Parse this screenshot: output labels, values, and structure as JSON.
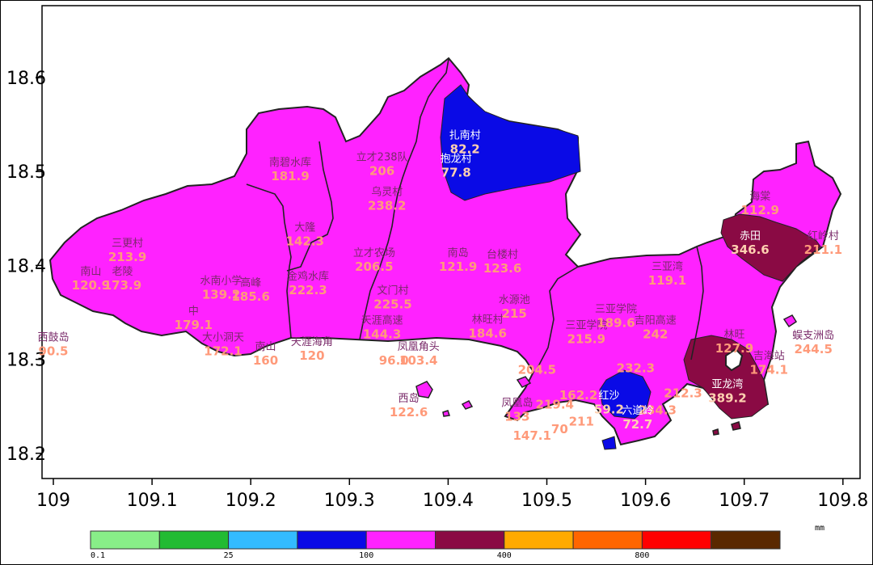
{
  "axes": {
    "x_ticks": [
      "109",
      "109.1",
      "109.2",
      "109.3",
      "109.4",
      "109.5",
      "109.6",
      "109.7",
      "109.8"
    ],
    "y_ticks": [
      "18.6",
      "18.5",
      "18.4",
      "18.3",
      "18.2"
    ]
  },
  "stations": [
    {
      "name": "扎南村",
      "value": "82.2",
      "lon": 109.417,
      "lat": 18.535,
      "zone": "blue"
    },
    {
      "name": "抱龙村",
      "value": "77.8",
      "lon": 109.408,
      "lat": 18.51,
      "zone": "blue"
    },
    {
      "name": "南碧水库",
      "value": "181.9",
      "lon": 109.24,
      "lat": 18.506,
      "zone": "magenta"
    },
    {
      "name": "立才238队",
      "value": "206",
      "lon": 109.333,
      "lat": 18.512,
      "zone": "magenta"
    },
    {
      "name": "乌灵村",
      "value": "238.2",
      "lon": 109.338,
      "lat": 18.475,
      "zone": "magenta"
    },
    {
      "name": "三更村",
      "value": "213.9",
      "lon": 109.075,
      "lat": 18.42,
      "zone": "magenta"
    },
    {
      "name": "南山",
      "value": "120.9",
      "lon": 109.038,
      "lat": 18.39,
      "zone": "magenta"
    },
    {
      "name": "老陵",
      "value": "173.9",
      "lon": 109.07,
      "lat": 18.39,
      "zone": "magenta"
    },
    {
      "name": "大隆",
      "value": "142.3",
      "lon": 109.255,
      "lat": 18.437,
      "zone": "magenta"
    },
    {
      "name": "水南小学",
      "value": "139.2",
      "lon": 109.17,
      "lat": 18.38,
      "zone": "magenta"
    },
    {
      "name": "高峰",
      "value": "185.6",
      "lon": 109.2,
      "lat": 18.378,
      "zone": "magenta"
    },
    {
      "name": "金鸡水库",
      "value": "222.3",
      "lon": 109.258,
      "lat": 18.385,
      "zone": "magenta"
    },
    {
      "name": "立才农场",
      "value": "206.5",
      "lon": 109.325,
      "lat": 18.41,
      "zone": "magenta"
    },
    {
      "name": "文门村",
      "value": "225.5",
      "lon": 109.344,
      "lat": 18.37,
      "zone": "magenta"
    },
    {
      "name": "南岛",
      "value": "121.9",
      "lon": 109.41,
      "lat": 18.41,
      "zone": "magenta"
    },
    {
      "name": "台楼村",
      "value": "123.6",
      "lon": 109.455,
      "lat": 18.408,
      "zone": "magenta"
    },
    {
      "name": "中",
      "value": "179.1",
      "lon": 109.142,
      "lat": 18.348,
      "zone": "magenta"
    },
    {
      "name": "西鼓岛",
      "value": "90.5",
      "lon": 109.0,
      "lat": 18.32,
      "zone": "magenta"
    },
    {
      "name": "大小洞天",
      "value": "172.1",
      "lon": 109.172,
      "lat": 18.32,
      "zone": "magenta"
    },
    {
      "name": "南山",
      "value": "160",
      "lon": 109.215,
      "lat": 18.31,
      "zone": "magenta"
    },
    {
      "name": "天涯海角",
      "value": "120",
      "lon": 109.262,
      "lat": 18.315,
      "zone": "magenta"
    },
    {
      "name": "天涯高速",
      "value": "144.3",
      "lon": 109.333,
      "lat": 18.338,
      "zone": "magenta"
    },
    {
      "name": "",
      "value": "96.0",
      "lon": 109.345,
      "lat": 18.31,
      "zone": "magenta"
    },
    {
      "name": "凤凰角头",
      "value": "103.4",
      "lon": 109.37,
      "lat": 18.31,
      "zone": "magenta"
    },
    {
      "name": "林旺村",
      "value": "184.6",
      "lon": 109.44,
      "lat": 18.339,
      "zone": "magenta"
    },
    {
      "name": "水源池",
      "value": "215",
      "lon": 109.467,
      "lat": 18.36,
      "zone": "magenta"
    },
    {
      "name": "西岛",
      "value": "122.6",
      "lon": 109.36,
      "lat": 18.255,
      "zone": "magenta"
    },
    {
      "name": "凤凰岛",
      "value": "133",
      "lon": 109.47,
      "lat": 18.25,
      "zone": "magenta"
    },
    {
      "name": "",
      "value": "204.5",
      "lon": 109.49,
      "lat": 18.3,
      "zone": "magenta"
    },
    {
      "name": "",
      "value": "219.4",
      "lon": 109.508,
      "lat": 18.263,
      "zone": "magenta"
    },
    {
      "name": "",
      "value": "147.1",
      "lon": 109.485,
      "lat": 18.23,
      "zone": "magenta"
    },
    {
      "name": "",
      "value": "70",
      "lon": 109.513,
      "lat": 18.237,
      "zone": "magenta"
    },
    {
      "name": "",
      "value": "162.2",
      "lon": 109.532,
      "lat": 18.273,
      "zone": "magenta"
    },
    {
      "name": "",
      "value": "211",
      "lon": 109.535,
      "lat": 18.245,
      "zone": "magenta"
    },
    {
      "name": "三亚学院",
      "value": "215.9",
      "lon": 109.54,
      "lat": 18.333,
      "zone": "magenta"
    },
    {
      "name": "三亚学院",
      "value": "189.6",
      "lon": 109.57,
      "lat": 18.35,
      "zone": "magenta"
    },
    {
      "name": "吉阳高速",
      "value": "242",
      "lon": 109.61,
      "lat": 18.338,
      "zone": "magenta"
    },
    {
      "name": "",
      "value": "232.3",
      "lon": 109.59,
      "lat": 18.302,
      "zone": "magenta"
    },
    {
      "name": "",
      "value": "212.3",
      "lon": 109.638,
      "lat": 18.275,
      "zone": "magenta"
    },
    {
      "name": "",
      "value": "234.3",
      "lon": 109.612,
      "lat": 18.257,
      "zone": "magenta"
    },
    {
      "name": "红沙",
      "value": "59.2",
      "lon": 109.563,
      "lat": 18.258,
      "zone": "blue"
    },
    {
      "name": "六道岭",
      "value": "72.7",
      "lon": 109.592,
      "lat": 18.242,
      "zone": "blue"
    },
    {
      "name": "三亚湾",
      "value": "119.1",
      "lon": 109.622,
      "lat": 18.395,
      "zone": "magenta"
    },
    {
      "name": "海棠",
      "value": "112.9",
      "lon": 109.716,
      "lat": 18.47,
      "zone": "magenta"
    },
    {
      "name": "赤田",
      "value": "346.6",
      "lon": 109.706,
      "lat": 18.428,
      "zone": "maroon"
    },
    {
      "name": "红岭村",
      "value": "211.1",
      "lon": 109.78,
      "lat": 18.428,
      "zone": "magenta"
    },
    {
      "name": "林旺",
      "value": "127.9",
      "lon": 109.69,
      "lat": 18.323,
      "zone": "magenta"
    },
    {
      "name": "亚龙湾",
      "value": "389.2",
      "lon": 109.683,
      "lat": 18.27,
      "zone": "maroon"
    },
    {
      "name": "吉海站",
      "value": "174.1",
      "lon": 109.725,
      "lat": 18.3,
      "zone": "magenta"
    },
    {
      "name": "蜈支洲岛",
      "value": "244.5",
      "lon": 109.77,
      "lat": 18.322,
      "zone": "magenta"
    }
  ],
  "colorbar": {
    "colors": [
      "#88ee88",
      "#22bb33",
      "#33bbff",
      "#0a0ae6",
      "#ff22ff",
      "#8a0a44",
      "#ffaa00",
      "#ff6600",
      "#ff0000",
      "#5a2800"
    ],
    "labels": [
      {
        "text": "0.1",
        "index": 0
      },
      {
        "text": "25",
        "index": 2
      },
      {
        "text": "100",
        "index": 4
      },
      {
        "text": "400",
        "index": 6
      },
      {
        "text": "800",
        "index": 8
      }
    ],
    "unit": "mm"
  },
  "zone_colors": {
    "magenta": "#ff22ff",
    "blue": "#0a0ae6",
    "maroon": "#8a0a44"
  }
}
